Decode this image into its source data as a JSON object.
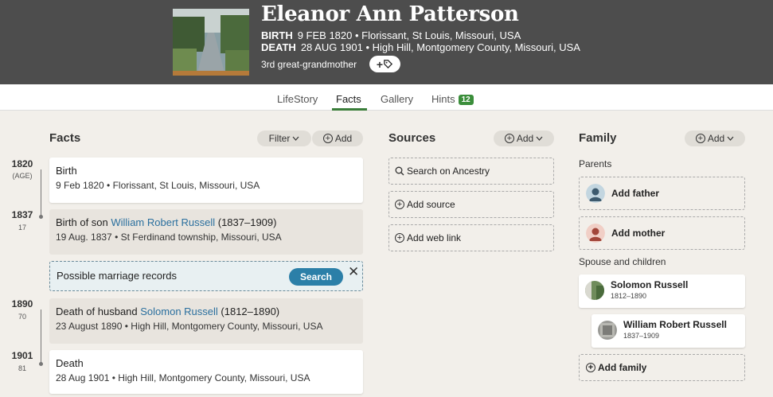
{
  "person": {
    "name": "Eleanor Ann Patterson",
    "birth_label": "BIRTH",
    "birth_value": "9 FEB 1820 • Florissant, St Louis, Missouri, USA",
    "death_label": "DEATH",
    "death_value": "28 AUG 1901 • High Hill, Montgomery County, Missouri, USA",
    "relationship": "3rd great-grandmother",
    "tag_button": "+"
  },
  "tabs": [
    {
      "label": "LifeStory"
    },
    {
      "label": "Facts"
    },
    {
      "label": "Gallery"
    },
    {
      "label": "Hints",
      "badge": "12"
    }
  ],
  "facts": {
    "title": "Facts",
    "filter_label": "Filter",
    "add_label": "Add",
    "timeline": [
      {
        "year": "1820",
        "age": "(AGE)"
      },
      {
        "year": "1837",
        "age": "17"
      },
      {
        "year": "1890",
        "age": "70"
      },
      {
        "year": "1901",
        "age": "81"
      }
    ],
    "events": [
      {
        "title": "Birth",
        "detail": "9 Feb 1820 • Florissant, St Louis, Missouri, USA"
      },
      {
        "title_prefix": "Birth of son ",
        "link": "William Robert Russell",
        "title_suffix": " (1837–1909)",
        "detail": "19 Aug. 1837 • St Ferdinand township, Missouri, USA"
      },
      {
        "title_prefix": "Death of husband ",
        "link": "Solomon Russell",
        "title_suffix": " (1812–1890)",
        "detail": "23 August 1890 • High Hill, Montgomery County, Missouri, USA"
      },
      {
        "title": "Death",
        "detail": "28 Aug 1901 • High Hill, Montgomery County, Missouri, USA"
      }
    ],
    "hint": {
      "text": "Possible marriage records",
      "search_label": "Search",
      "close": "✕"
    }
  },
  "sources": {
    "title": "Sources",
    "add_label": "Add",
    "items": [
      {
        "label": "Search on Ancestry",
        "icon": "search-icon"
      },
      {
        "label": "Add source",
        "icon": "plus-circle-icon"
      },
      {
        "label": "Add web link",
        "icon": "plus-circle-icon"
      }
    ]
  },
  "family": {
    "title": "Family",
    "add_label": "Add",
    "parents_label": "Parents",
    "add_father": "Add father",
    "add_mother": "Add mother",
    "spouse_label": "Spouse and children",
    "spouse": {
      "name": "Solomon Russell",
      "dates": "1812–1890"
    },
    "child": {
      "name": "William Robert Russell",
      "dates": "1837–1909"
    },
    "add_family": "Add family"
  },
  "colors": {
    "header_bg": "#4d4d4d",
    "active_tab": "#3a7d3a",
    "link": "#2a6f9e",
    "search_button": "#2b7fa8"
  }
}
